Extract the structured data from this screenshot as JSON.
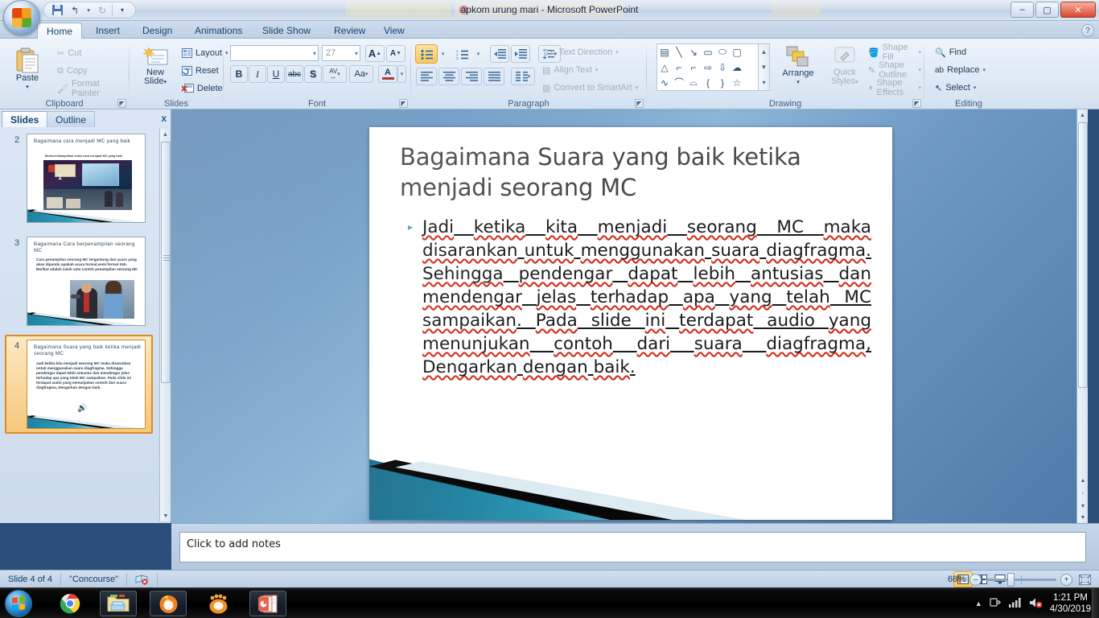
{
  "window": {
    "title": "apkom urung mari - Microsoft PowerPoint",
    "minimize": "–",
    "maximize": "▢",
    "close": "✕",
    "help": "?"
  },
  "quick_access": {
    "save": "save-icon",
    "undo": "↰",
    "undo_arrow": "▾",
    "redo": "↻",
    "customize": "▾"
  },
  "ribbon_tabs": [
    {
      "label": "Home",
      "active": true
    },
    {
      "label": "Insert",
      "active": false
    },
    {
      "label": "Design",
      "active": false
    },
    {
      "label": "Animations",
      "active": false
    },
    {
      "label": "Slide Show",
      "active": false
    },
    {
      "label": "Review",
      "active": false
    },
    {
      "label": "View",
      "active": false
    }
  ],
  "ribbon": {
    "clipboard": {
      "name": "Clipboard",
      "paste": "Paste",
      "paste_arrow": "▾",
      "cut": "Cut",
      "copy": "Copy",
      "format_painter": "Format Painter"
    },
    "slides": {
      "name": "Slides",
      "new_slide": "New\nSlide",
      "new_slide_line1": "New",
      "new_slide_line2": "Slide",
      "new_slide_arrow": "▾",
      "layout": "Layout",
      "reset": "Reset",
      "delete": "Delete"
    },
    "font": {
      "name": "Font",
      "font_name_value": "",
      "font_name_placeholder": "",
      "font_size_value": "27",
      "grow_font": "A",
      "shrink_font": "A",
      "clear_formatting": "Aa",
      "bold": "B",
      "italic": "I",
      "underline": "U",
      "strikethrough": "abc",
      "shadow": "S",
      "char_spacing": "AV",
      "change_case": "Aa",
      "font_color": "A"
    },
    "paragraph": {
      "name": "Paragraph",
      "bullets": "bullets-icon",
      "numbering": "numbering-icon",
      "decrease_indent": "decrease-indent-icon",
      "increase_indent": "increase-indent-icon",
      "line_spacing": "line-spacing-icon",
      "align_left": "align-left-icon",
      "align_center": "align-center-icon",
      "align_right": "align-right-icon",
      "justify": "justify-icon",
      "columns": "columns-icon",
      "text_direction": "Text Direction",
      "align_text": "Align Text",
      "convert_smartart": "Convert to SmartArt"
    },
    "drawing": {
      "name": "Drawing",
      "arrange": "Arrange",
      "arrange_arrow": "▾",
      "quick_styles_line1": "Quick",
      "quick_styles_line2": "Styles",
      "shape_fill": "Shape Fill",
      "shape_outline": "Shape Outline",
      "shape_effects": "Shape Effects",
      "shapes": [
        "▤",
        "╲",
        "↘",
        "▭",
        "⬭",
        "▢",
        "△",
        "⊐",
        "⊏",
        "⇨",
        "⇩",
        "☁",
        "∿",
        "⌒",
        "⌓",
        "{",
        "}",
        "☆"
      ]
    },
    "editing": {
      "name": "Editing",
      "find": "Find",
      "replace": "Replace",
      "select": "Select"
    }
  },
  "slides_pane": {
    "tab_slides": "Slides",
    "tab_outline": "Outline",
    "close": "x",
    "thumbnails": [
      {
        "number": "2",
        "title": "Bagaimana cara menjadi MC yang baik",
        "body": "Berikut ditampilkan video cara menjadi MC yang baik",
        "selected": false,
        "has_image": true,
        "has_audio": false
      },
      {
        "number": "3",
        "title": "Bagaimana Cara berpenampilan seorang MC",
        "body": "Cara penampilan seorang MC tergantung dari acara yang akan dipandu apakah acara formal,semi formal dsb. Berikut adalah salah satu contoh penampilan seorang MC",
        "selected": false,
        "has_image": true,
        "has_audio": false
      },
      {
        "number": "4",
        "title": "Bagaimana Suara yang baik ketika menjadi seorang MC",
        "body": "Jadi ketika kita menjadi seorang MC maka disarankan untuk menggunakan suara diagfragma. Sehingga pendengar dapat lebih antusias dan mendengar jelas terhadap apa yang telah MC sampaikan. Pada slide ini terdapat audio yang menunjukan contoh dari suara diagfragma, Dengarkan dengan baik.",
        "selected": true,
        "has_image": false,
        "has_audio": true
      }
    ]
  },
  "slide": {
    "title": "Bagaimana Suara yang baik ketika menjadi seorang MC",
    "bullet_marker": "▸",
    "body_segments": [
      {
        "text": "Jadi",
        "spell": true
      },
      {
        "text": " ",
        "spell": false
      },
      {
        "text": "ketika",
        "spell": true
      },
      {
        "text": " ",
        "spell": false
      },
      {
        "text": "kita",
        "spell": true
      },
      {
        "text": " ",
        "spell": false
      },
      {
        "text": "menjadi",
        "spell": true
      },
      {
        "text": " ",
        "spell": false
      },
      {
        "text": "seorang",
        "spell": true
      },
      {
        "text": " MC ",
        "spell": false
      },
      {
        "text": "maka",
        "spell": true
      },
      {
        "text": " ",
        "spell": false
      },
      {
        "text": "disarankan",
        "spell": true
      },
      {
        "text": " ",
        "spell": false
      },
      {
        "text": "untuk",
        "spell": true
      },
      {
        "text": " ",
        "spell": false
      },
      {
        "text": "menggunakan",
        "spell": true
      },
      {
        "text": " ",
        "spell": false
      },
      {
        "text": "suara",
        "spell": true
      },
      {
        "text": " ",
        "spell": false
      },
      {
        "text": "diagfragma",
        "spell": true
      },
      {
        "text": ". ",
        "spell": false
      },
      {
        "text": "Sehingga",
        "spell": true
      },
      {
        "text": " ",
        "spell": false
      },
      {
        "text": "pendengar",
        "spell": true
      },
      {
        "text": " ",
        "spell": false
      },
      {
        "text": "dapat",
        "spell": true
      },
      {
        "text": " ",
        "spell": false
      },
      {
        "text": "lebih",
        "spell": true
      },
      {
        "text": " ",
        "spell": false
      },
      {
        "text": "antusias",
        "spell": true
      },
      {
        "text": " ",
        "spell": false
      },
      {
        "text": "dan",
        "spell": true
      },
      {
        "text": " ",
        "spell": false
      },
      {
        "text": "mendengar",
        "spell": true
      },
      {
        "text": " ",
        "spell": false
      },
      {
        "text": "jelas",
        "spell": true
      },
      {
        "text": " ",
        "spell": false
      },
      {
        "text": "terhadap",
        "spell": true
      },
      {
        "text": " ",
        "spell": false
      },
      {
        "text": "apa",
        "spell": true
      },
      {
        "text": " ",
        "spell": false
      },
      {
        "text": "yang",
        "spell": true
      },
      {
        "text": " ",
        "spell": false
      },
      {
        "text": "telah",
        "spell": true
      },
      {
        "text": " MC ",
        "spell": false
      },
      {
        "text": "sampaikan",
        "spell": true
      },
      {
        "text": ". ",
        "spell": false
      },
      {
        "text": "Pada",
        "spell": true
      },
      {
        "text": " slide ",
        "spell": false
      },
      {
        "text": "ini",
        "spell": true
      },
      {
        "text": " ",
        "spell": false
      },
      {
        "text": "terdapat",
        "spell": true
      },
      {
        "text": " audio ",
        "spell": false
      },
      {
        "text": "yang",
        "spell": true
      },
      {
        "text": " ",
        "spell": false
      },
      {
        "text": "menunjukan",
        "spell": true
      },
      {
        "text": " ",
        "spell": false
      },
      {
        "text": "contoh",
        "spell": true
      },
      {
        "text": " ",
        "spell": false
      },
      {
        "text": "dari",
        "spell": true
      },
      {
        "text": " ",
        "spell": false
      },
      {
        "text": "suara",
        "spell": true
      },
      {
        "text": " ",
        "spell": false
      },
      {
        "text": "diagfragma",
        "spell": true
      },
      {
        "text": ", ",
        "spell": false
      },
      {
        "text": "Dengarkan",
        "spell": true
      },
      {
        "text": " ",
        "spell": false
      },
      {
        "text": "dengan",
        "spell": true
      },
      {
        "text": " ",
        "spell": false
      },
      {
        "text": "baik",
        "spell": true
      },
      {
        "text": ".",
        "spell": false
      }
    ],
    "body_plain": "Jadi ketika kita menjadi seorang MC maka disarankan untuk menggunakan suara diagfragma. Sehingga pendengar dapat lebih antusias dan mendengar jelas terhadap apa yang telah MC sampaikan. Pada slide ini terdapat audio yang menunjukan contoh dari suara diagfragma, Dengarkan dengan baik.",
    "audio_object": "speaker-icon"
  },
  "notes": {
    "placeholder": "Click to add notes"
  },
  "status_bar": {
    "slide_counter": "Slide 4 of 4",
    "theme": "\"Concourse\"",
    "spellcheck": "spellcheck-error-icon",
    "view_normal": "normal-view-icon",
    "view_sorter": "slide-sorter-icon",
    "view_show": "slideshow-icon",
    "zoom_value": "68%",
    "zoom_out": "–",
    "zoom_in": "+",
    "fit_slide": "fit-to-window-icon"
  },
  "taskbar": {
    "start": "start-orb",
    "items": [
      {
        "name": "chrome-taskbar-icon",
        "open": false
      },
      {
        "name": "file-explorer-taskbar-icon",
        "open": true
      },
      {
        "name": "firefox-taskbar-icon",
        "open": true
      },
      {
        "name": "gom-player-taskbar-icon",
        "open": false
      },
      {
        "name": "powerpoint-taskbar-icon",
        "open": true
      }
    ],
    "tray": {
      "show_hidden": "▲",
      "power": "power-icon",
      "network": "signal-icon",
      "volume": "volume-muted-icon",
      "time": "1:21 PM",
      "date": "4/30/2019"
    }
  }
}
